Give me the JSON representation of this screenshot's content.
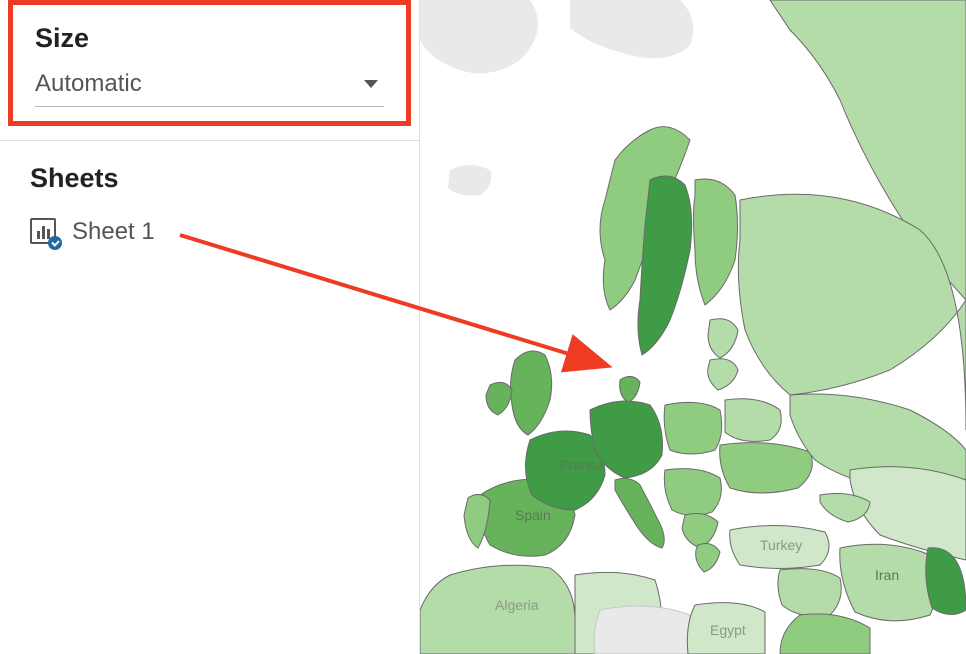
{
  "panel": {
    "size_label": "Size",
    "size_value": "Automatic",
    "sheets_label": "Sheets",
    "sheet_items": [
      {
        "name": "Sheet 1"
      }
    ]
  },
  "map": {
    "region_label_france": "France",
    "region_label_spain": "Spain",
    "region_label_algeria": "Algeria",
    "region_label_egypt": "Egypt",
    "region_label_turkey": "Turkey",
    "region_label_iran": "Iran",
    "colors": {
      "water": "#ffffff",
      "land_light": "#e9e9e7",
      "choropleth_lightest": "#d0e7c9",
      "choropleth_light": "#b3dca8",
      "choropleth_mid": "#8fcc80",
      "choropleth_dark": "#66b35b",
      "choropleth_darkest": "#3f9b46",
      "border": "#6a6a6a"
    }
  },
  "annotation": {
    "stroke": "#ed3b24"
  }
}
